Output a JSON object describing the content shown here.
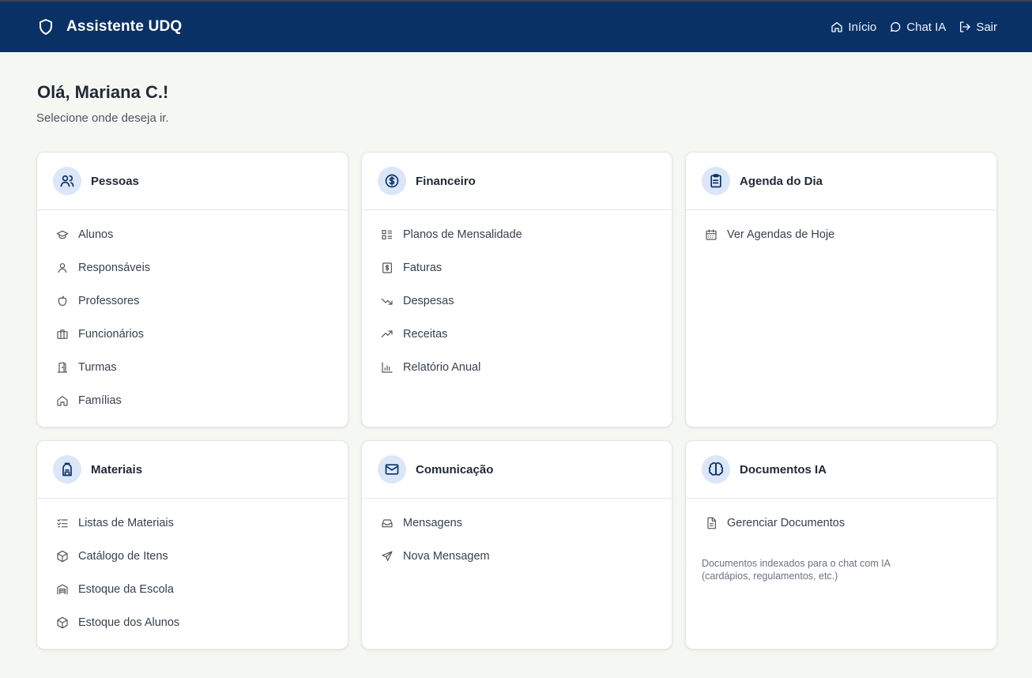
{
  "header": {
    "title": "Assistente UDQ",
    "nav": [
      {
        "label": "Início",
        "icon": "home-icon"
      },
      {
        "label": "Chat IA",
        "icon": "chat-bubble-icon"
      },
      {
        "label": "Sair",
        "icon": "logout-icon"
      }
    ]
  },
  "greeting": "Olá, Mariana C.!",
  "subtitle": "Selecione onde deseja ir.",
  "colors": {
    "header_bg": "#0a3166",
    "page_bg": "#f5f7f2",
    "icon_bubble": "#dbe7f8",
    "icon_stroke": "#0a3166"
  },
  "cards": {
    "pessoas": {
      "title": "Pessoas",
      "icon": "users-icon",
      "items": [
        {
          "label": "Alunos",
          "icon": "graduation-cap-icon"
        },
        {
          "label": "Responsáveis",
          "icon": "user-icon"
        },
        {
          "label": "Professores",
          "icon": "apple-icon"
        },
        {
          "label": "Funcionários",
          "icon": "briefcase-icon"
        },
        {
          "label": "Turmas",
          "icon": "door-icon"
        },
        {
          "label": "Famílias",
          "icon": "home-icon"
        }
      ]
    },
    "financeiro": {
      "title": "Financeiro",
      "icon": "dollar-circle-icon",
      "items": [
        {
          "label": "Planos de Mensalidade",
          "icon": "list-icon"
        },
        {
          "label": "Faturas",
          "icon": "receipt-icon"
        },
        {
          "label": "Despesas",
          "icon": "trending-down-icon"
        },
        {
          "label": "Receitas",
          "icon": "trending-up-icon"
        },
        {
          "label": "Relatório Anual",
          "icon": "bar-chart-icon"
        }
      ]
    },
    "agenda": {
      "title": "Agenda do Dia",
      "icon": "clipboard-icon",
      "items": [
        {
          "label": "Ver Agendas de Hoje",
          "icon": "calendar-icon"
        }
      ]
    },
    "materiais": {
      "title": "Materiais",
      "icon": "backpack-icon",
      "items": [
        {
          "label": "Listas de Materiais",
          "icon": "checklist-icon"
        },
        {
          "label": "Catálogo de Itens",
          "icon": "box-icon"
        },
        {
          "label": "Estoque da Escola",
          "icon": "warehouse-icon"
        },
        {
          "label": "Estoque dos Alunos",
          "icon": "box-icon"
        }
      ]
    },
    "comunicacao": {
      "title": "Comunicação",
      "icon": "mail-icon",
      "items": [
        {
          "label": "Mensagens",
          "icon": "inbox-icon"
        },
        {
          "label": "Nova Mensagem",
          "icon": "send-icon"
        }
      ]
    },
    "documentos": {
      "title": "Documentos IA",
      "icon": "brain-icon",
      "items": [
        {
          "label": "Gerenciar Documentos",
          "icon": "file-text-icon"
        }
      ],
      "note": "Documentos indexados para o chat com IA (cardápios, regulamentos, etc.)"
    }
  }
}
